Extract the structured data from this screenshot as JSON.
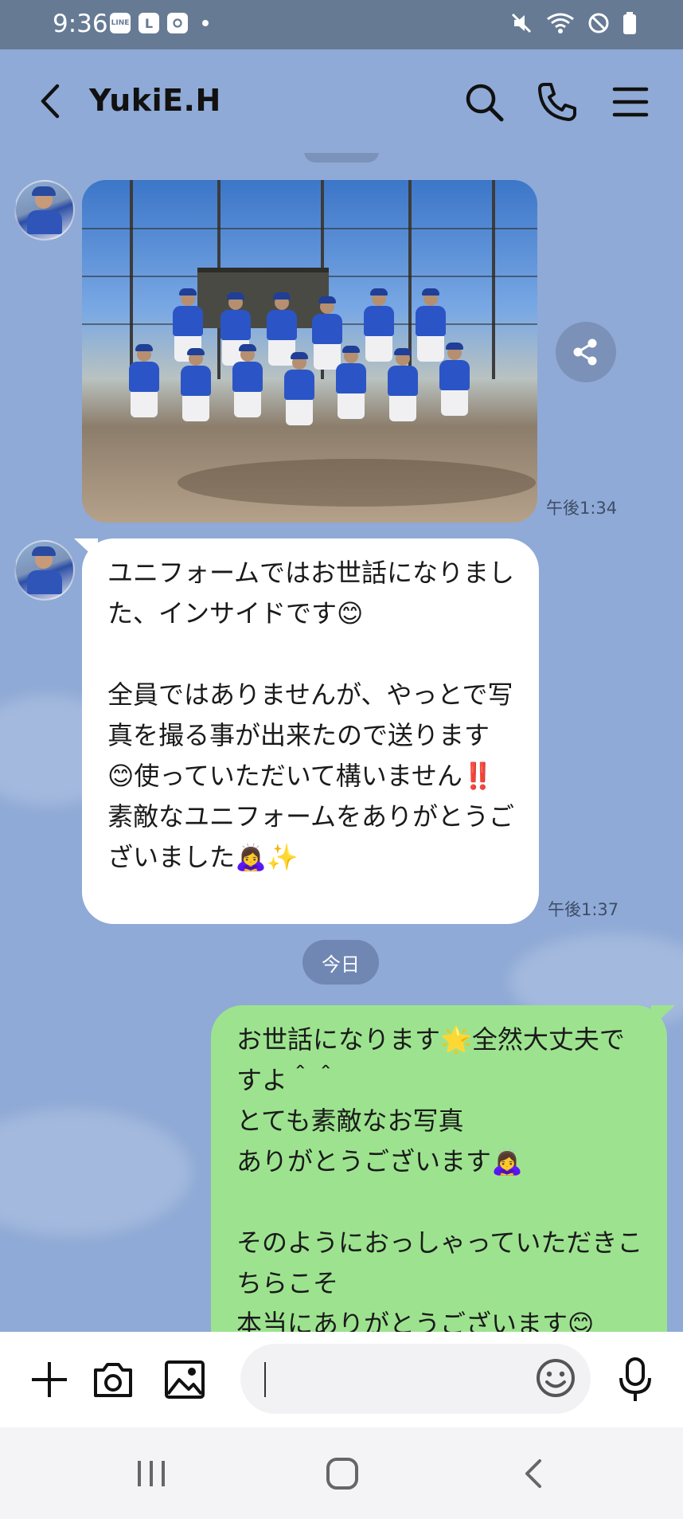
{
  "status_bar": {
    "time": "9:36",
    "left_icons": [
      "line-notification-icon",
      "l-app-icon",
      "instagram-icon",
      "dot-icon"
    ],
    "left_icon_labels": [
      "LINE",
      "L"
    ],
    "right_icons": [
      "mute-icon",
      "wifi-icon",
      "do-not-disturb-icon",
      "battery-icon"
    ]
  },
  "header": {
    "title": "YukiE.H",
    "buttons": [
      "back-icon",
      "search-icon",
      "call-icon",
      "menu-icon"
    ]
  },
  "messages": [
    {
      "type": "image",
      "direction": "incoming",
      "content": "team-photo",
      "timestamp": "午後1:34"
    },
    {
      "type": "text",
      "direction": "incoming",
      "text": "ユニフォームではお世話になりました、インサイドです😊\n\n全員ではありませんが、やっとで写真を撮る事が出来たので送ります😊使っていただいて構いません‼️\n素敵なユニフォームをありがとうございました🙇‍♀️✨",
      "timestamp": "午後1:37"
    },
    {
      "type": "date_separator",
      "text": "今日"
    },
    {
      "type": "text",
      "direction": "outgoing",
      "text": "お世話になります🌟全然大丈夫ですよ＾＾\nとても素敵なお写真\nありがとうございます🙇‍♀️\n\nそのようにおっしゃっていただきこちらこそ\n本当にありがとうございます😊"
    }
  ],
  "input_bar": {
    "placeholder": "",
    "buttons": [
      "plus-icon",
      "camera-icon",
      "image-icon",
      "emoji-icon",
      "microphone-icon"
    ]
  },
  "nav_bar": {
    "buttons": [
      "recent-apps-icon",
      "home-icon",
      "back-nav-icon"
    ]
  },
  "colors": {
    "chat_background": "#8faad6",
    "status_bar": "#667a94",
    "outgoing_bubble": "#9de38f",
    "incoming_bubble": "#ffffff",
    "uniform_blue": "#2b55c6"
  }
}
